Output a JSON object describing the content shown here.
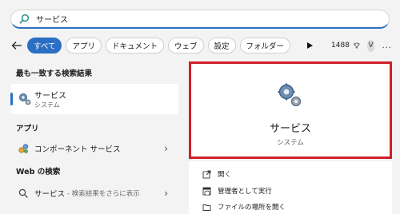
{
  "search": {
    "query": "サービス",
    "icon": "search-icon"
  },
  "filters": {
    "back_icon": "back-arrow-icon",
    "chips": [
      {
        "label": "すべて",
        "active": true
      },
      {
        "label": "アプリ",
        "active": false
      },
      {
        "label": "ドキュメント",
        "active": false
      },
      {
        "label": "ウェブ",
        "active": false
      },
      {
        "label": "設定",
        "active": false
      },
      {
        "label": "フォルダー",
        "active": false
      }
    ],
    "points": "1488",
    "avatar": "V",
    "more": "..."
  },
  "left": {
    "best_match_header": "最も一致する検索結果",
    "best_match": {
      "title": "サービス",
      "subtitle": "システム",
      "icon": "services-gear-icon"
    },
    "apps_header": "アプリ",
    "apps": [
      {
        "label": "コンポーネント サービス",
        "icon": "component-services-icon"
      }
    ],
    "web_header": "Web の検索",
    "web": [
      {
        "label": "サービス",
        "sub": "- 検索結果をさらに表示",
        "icon": "search-icon"
      }
    ]
  },
  "detail": {
    "title": "サービス",
    "category": "システム",
    "icon": "services-gear-icon",
    "actions": [
      {
        "label": "開く",
        "icon": "open-icon"
      },
      {
        "label": "管理者として実行",
        "icon": "run-as-admin-icon"
      },
      {
        "label": "ファイルの場所を開く",
        "icon": "folder-icon"
      }
    ]
  },
  "colors": {
    "accent": "#2b6fc4",
    "highlight_border": "#d11f2a"
  }
}
